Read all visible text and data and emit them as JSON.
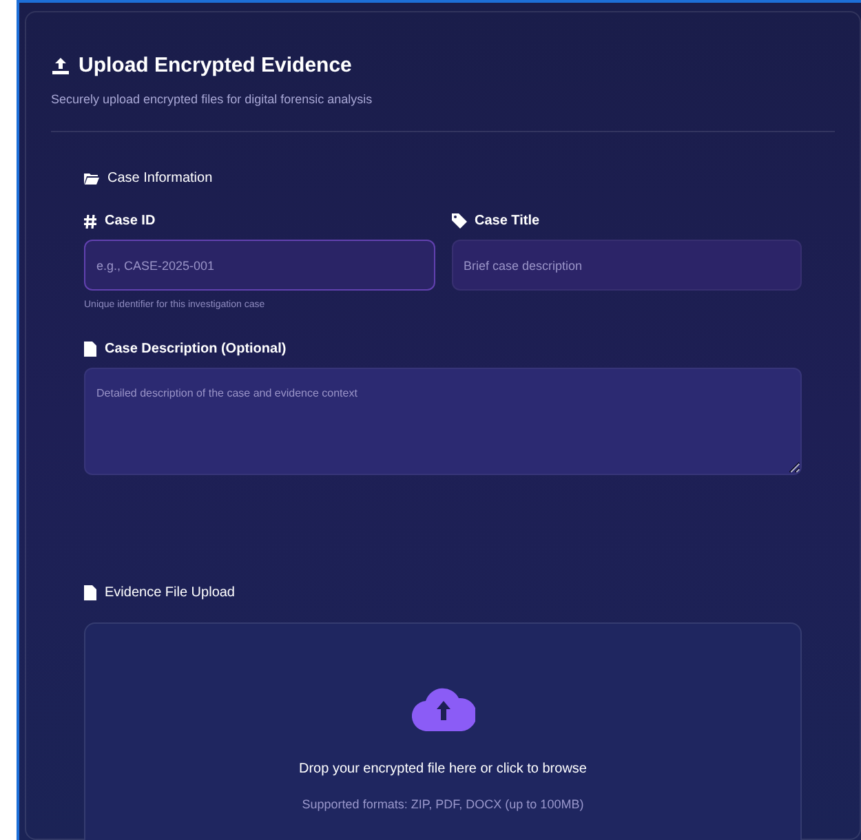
{
  "header": {
    "title": "Upload Encrypted Evidence",
    "subtitle": "Securely upload encrypted files for digital forensic analysis"
  },
  "case_information": {
    "heading": "Case Information",
    "case_id": {
      "label": "Case ID",
      "placeholder": "e.g., CASE-2025-001",
      "hint": "Unique identifier for this investigation case"
    },
    "case_title": {
      "label": "Case Title",
      "placeholder": "Brief case description"
    },
    "case_description": {
      "label": "Case Description (Optional)",
      "placeholder": "Detailed description of the case and evidence context"
    }
  },
  "evidence_upload": {
    "heading": "Evidence File Upload",
    "drop_text": "Drop your encrypted file here or click to browse",
    "formats": "Supported formats: ZIP, PDF, DOCX (up to 100MB)"
  }
}
